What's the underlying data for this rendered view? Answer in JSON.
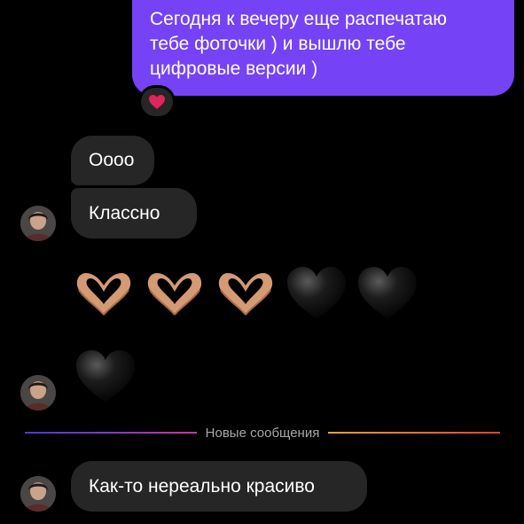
{
  "messages": {
    "outgoing": {
      "lines": [
        "Сегодня к вечеру еще распечатаю",
        "тебе фоточки ) и вышлю тебе",
        "цифровые версии )"
      ],
      "reaction": "❤️"
    },
    "incoming": [
      "Оооо",
      "Классно",
      "Как-то нереально красиво"
    ]
  },
  "separator": {
    "label": "Новые сообщения"
  },
  "emoji_messages": {
    "row": [
      "heart-hands",
      "heart-hands",
      "heart-hands",
      "black-heart",
      "black-heart"
    ],
    "single": [
      "black-heart"
    ]
  },
  "colors": {
    "background": "#000000",
    "outgoing_bubble": "#7542f5",
    "incoming_bubble": "#262626",
    "reaction_heart": "#e0245e"
  }
}
